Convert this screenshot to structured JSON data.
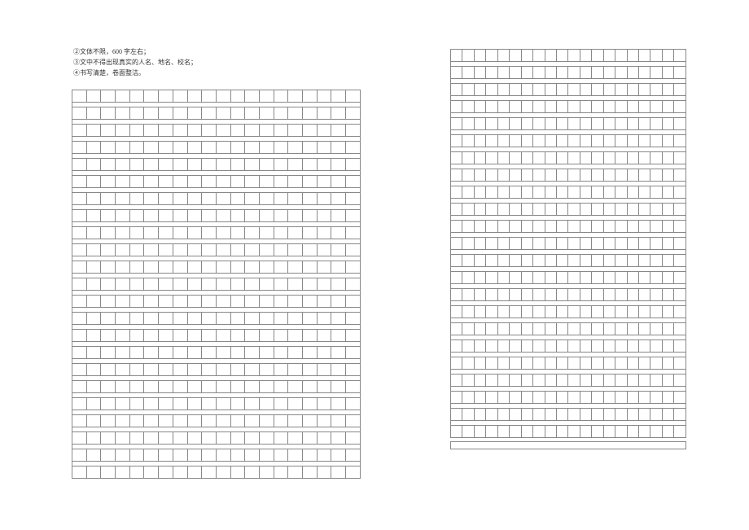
{
  "instructions": {
    "line1": "②文体不限，600 字左右；",
    "line2": "③文中不得出现真实的人名、地名、校名；",
    "line3": "④书写清楚，卷面整洁。"
  },
  "grid": {
    "left_cols": 20,
    "left_rows": 23,
    "right_cols": 20,
    "right_rows": 23
  }
}
